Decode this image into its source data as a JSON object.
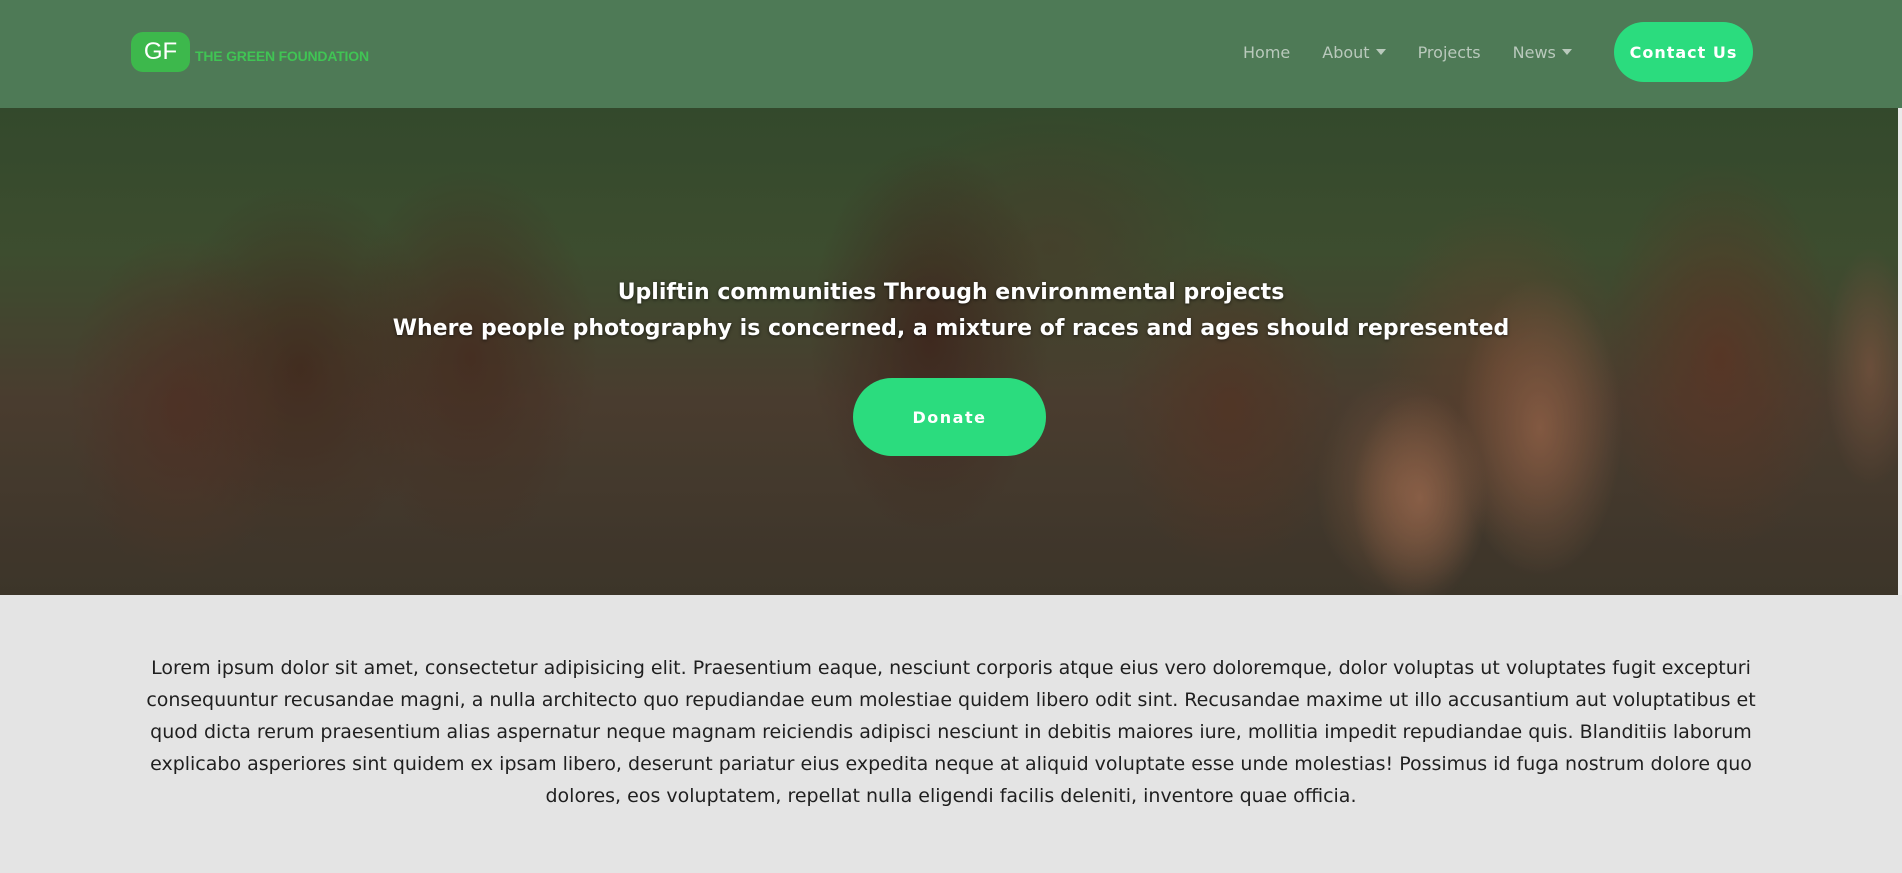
{
  "navbar": {
    "logo_badge": "GF",
    "logo_text": "THE GREEN FOUNDATION",
    "links": [
      {
        "label": "Home",
        "dropdown": false
      },
      {
        "label": "About",
        "dropdown": true
      },
      {
        "label": "Projects",
        "dropdown": false
      },
      {
        "label": "News",
        "dropdown": true
      }
    ],
    "contact_label": "Contact Us"
  },
  "hero": {
    "heading": "Upliftin communities Through environmental projects",
    "subheading": "Where people photography is concerned, a mixture of races and ages should represented",
    "donate_label": "Donate"
  },
  "intro": {
    "text": "Lorem ipsum dolor sit amet, consectetur adipisicing elit. Praesentium eaque, nesciunt corporis atque eius vero doloremque, dolor voluptas ut voluptates fugit excepturi consequuntur recusandae magni, a nulla architecto quo repudiandae eum molestiae quidem libero odit sint. Recusandae maxime ut illo accusantium aut voluptatibus et quod dicta rerum praesentium alias aspernatur neque magnam reiciendis adipisci nesciunt in debitis maiores iure, mollitia impedit repudiandae quis. Blanditiis laborum explicabo asperiores sint quidem ex ipsam libero, deserunt pariatur eius expedita neque at aliquid voluptate esse unde molestias! Possimus id fuga nostrum dolore quo dolores, eos voluptatem, repellat nulla eligendi facilis deleniti, inventore quae officia."
  },
  "colors": {
    "navbar_bg": "#4e7a56",
    "accent": "#2bdc7e",
    "logo_green": "#3db84c",
    "page_bg": "#e4e4e4"
  }
}
